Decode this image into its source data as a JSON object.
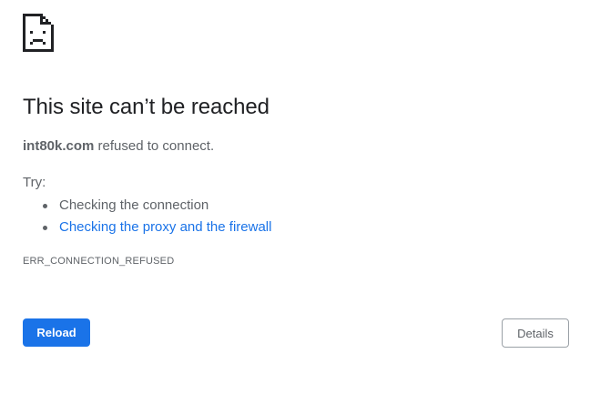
{
  "error": {
    "icon": "sad-page-icon",
    "title": "This site can’t be reached",
    "host": "int80k.com",
    "summary_suffix": " refused to connect.",
    "try_label": "Try:",
    "suggestions": [
      {
        "label": "Checking the connection",
        "link": false
      },
      {
        "label": "Checking the proxy and the firewall",
        "link": true
      }
    ],
    "code": "ERR_CONNECTION_REFUSED"
  },
  "buttons": {
    "reload_label": "Reload",
    "details_label": "Details"
  },
  "colors": {
    "accent": "#1a73e8",
    "text": "#5f6368",
    "title": "#202124",
    "border": "#9aa0a6"
  }
}
